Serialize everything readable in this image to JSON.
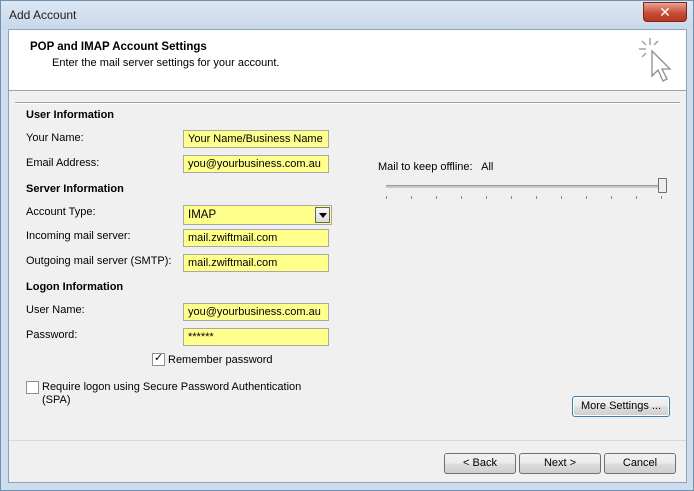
{
  "window": {
    "title": "Add Account",
    "close": "✕"
  },
  "header": {
    "title": "POP and IMAP Account Settings",
    "subtitle": "Enter the mail server settings for your account."
  },
  "user_info": {
    "heading": "User Information",
    "name_label": "Your Name:",
    "name_value": "Your Name/Business Name",
    "email_label": "Email Address:",
    "email_value": "you@yourbusiness.com.au"
  },
  "server_info": {
    "heading": "Server Information",
    "account_type_label": "Account Type:",
    "account_type_value": "IMAP",
    "incoming_label": "Incoming mail server:",
    "incoming_value": "mail.zwiftmail.com",
    "outgoing_label": "Outgoing mail server (SMTP):",
    "outgoing_value": "mail.zwiftmail.com"
  },
  "logon_info": {
    "heading": "Logon Information",
    "username_label": "User Name:",
    "username_value": "you@yourbusiness.com.au",
    "password_label": "Password:",
    "password_value": "******",
    "remember_label": "Remember password",
    "remember_checked": true,
    "spa_label_line1": "Require logon using Secure Password Authentication",
    "spa_label_line2": "(SPA)",
    "spa_checked": false
  },
  "offline": {
    "label": "Mail to keep offline:",
    "value": "All",
    "slider_level": 1.0
  },
  "buttons": {
    "more_settings": "More Settings ...",
    "back": "< Back",
    "next": "Next >",
    "cancel": "Cancel"
  }
}
